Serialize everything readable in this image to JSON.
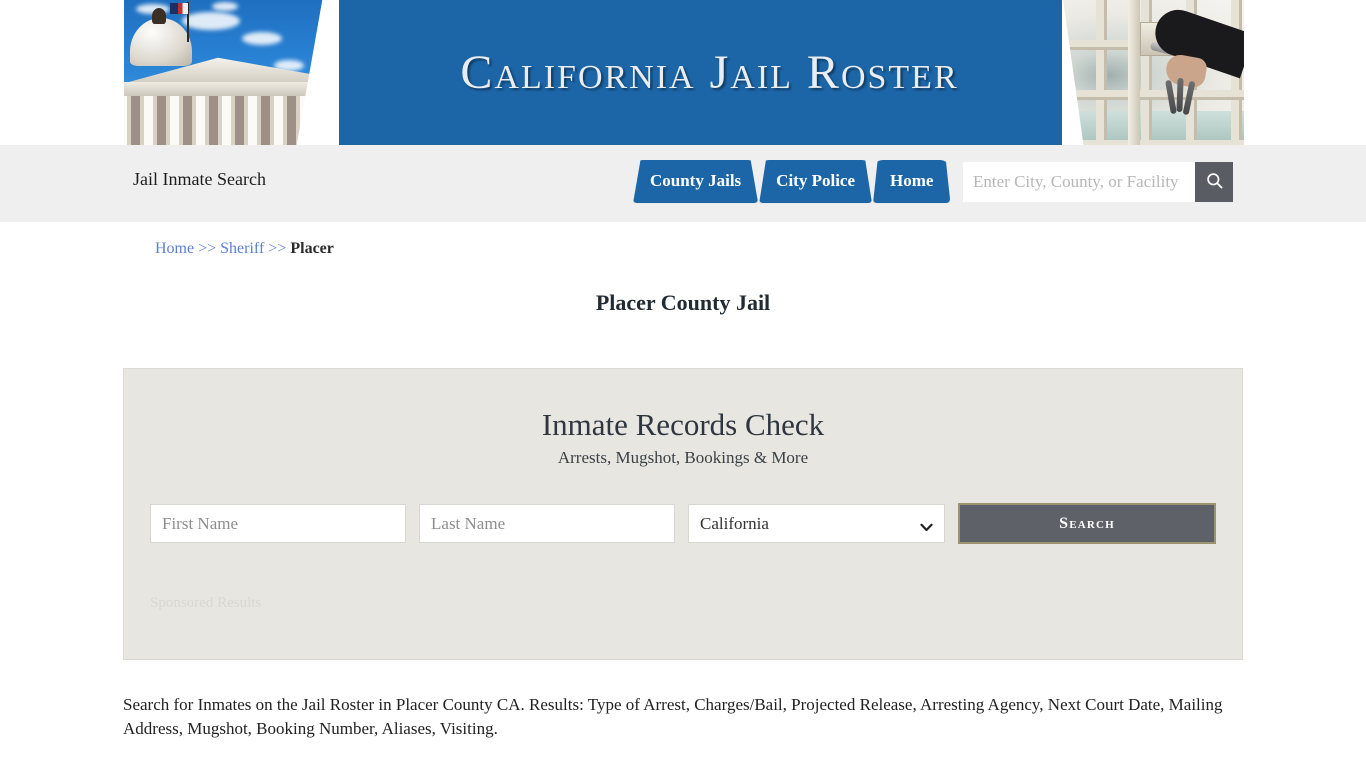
{
  "banner": {
    "title": "California Jail Roster",
    "left_image_alt": "state-capitol-photo",
    "right_image_alt": "jail-door-keys-photo",
    "blue": "#1c66a8"
  },
  "navbar": {
    "brand": "Jail Inmate Search",
    "tabs": [
      {
        "label": "County Jails"
      },
      {
        "label": "City Police"
      },
      {
        "label": "Home"
      }
    ],
    "search": {
      "placeholder": "Enter City, County, or Facility",
      "value": "",
      "button_icon": "search-icon"
    }
  },
  "breadcrumb": {
    "home": "Home",
    "sep1": ">>",
    "sheriff": "Sheriff",
    "sep2": ">>",
    "current": "Placer"
  },
  "page": {
    "title": "Placer County Jail",
    "description": "Search for Inmates on the Jail Roster in Placer County CA. Results: Type of Arrest, Charges/Bail, Projected Release, Arresting Agency, Next Court Date, Mailing Address, Mugshot, Booking Number, Aliases, Visiting."
  },
  "card": {
    "title": "Inmate Records Check",
    "subtitle": "Arrests, Mugshot, Bookings & More",
    "first_name_placeholder": "First Name",
    "first_name_value": "",
    "last_name_placeholder": "Last Name",
    "last_name_value": "",
    "state_selected": "California",
    "state_options": [
      "California"
    ],
    "search_button": "Search",
    "sponsored_label": "Sponsored Results",
    "background": "#e8e6e0",
    "button_color": "#5f6169"
  }
}
